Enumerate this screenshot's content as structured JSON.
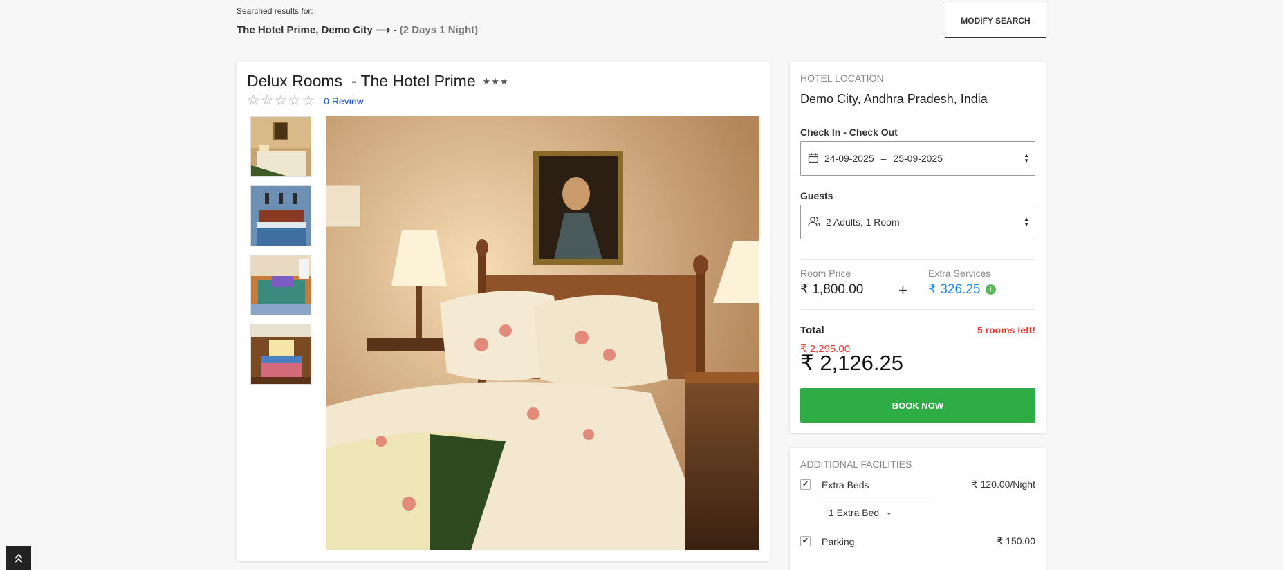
{
  "search": {
    "label": "Searched results for:",
    "query": "The Hotel Prime, Demo City",
    "arrow": "⟶",
    "separator": "-",
    "duration": "(2 Days 1 Night)",
    "modify_label": "MODIFY SEARCH"
  },
  "room": {
    "title": "Delux Rooms  - The Hotel Prime",
    "hotel_stars": "★★★",
    "rating_stars": 0,
    "review_link": "0 Review"
  },
  "booking": {
    "location_heading": "HOTEL LOCATION",
    "location": "Demo City, Andhra Pradesh, India",
    "dates_label": "Check In - Check Out",
    "check_in": "24-09-2025",
    "dates_dash": "–",
    "check_out": "25-09-2025",
    "guests_label": "Guests",
    "guests_value": "2 Adults, 1 Room",
    "room_price_label": "Room Price",
    "room_price": "₹ 1,800.00",
    "plus": "+",
    "extra_services_label": "Extra Services",
    "extra_services": "₹ 326.25",
    "total_label": "Total",
    "rooms_left": "5 rooms left!",
    "old_total": "₹ 2,295.00",
    "total": "₹ 2,126.25",
    "book_label": "BOOK NOW"
  },
  "facilities": {
    "heading": "ADDITIONAL FACILITIES",
    "items": [
      {
        "name": "Extra Beds",
        "price": "₹ 120.00/Night",
        "checked": true
      },
      {
        "name": "Parking",
        "price": "₹ 150.00",
        "checked": true
      }
    ],
    "extra_bed_option": "1 Extra Bed"
  },
  "colors": {
    "accent_green": "#2eac46",
    "alert_red": "#e53935",
    "link_blue": "#1a55c8",
    "info_blue": "#1e88e5"
  }
}
